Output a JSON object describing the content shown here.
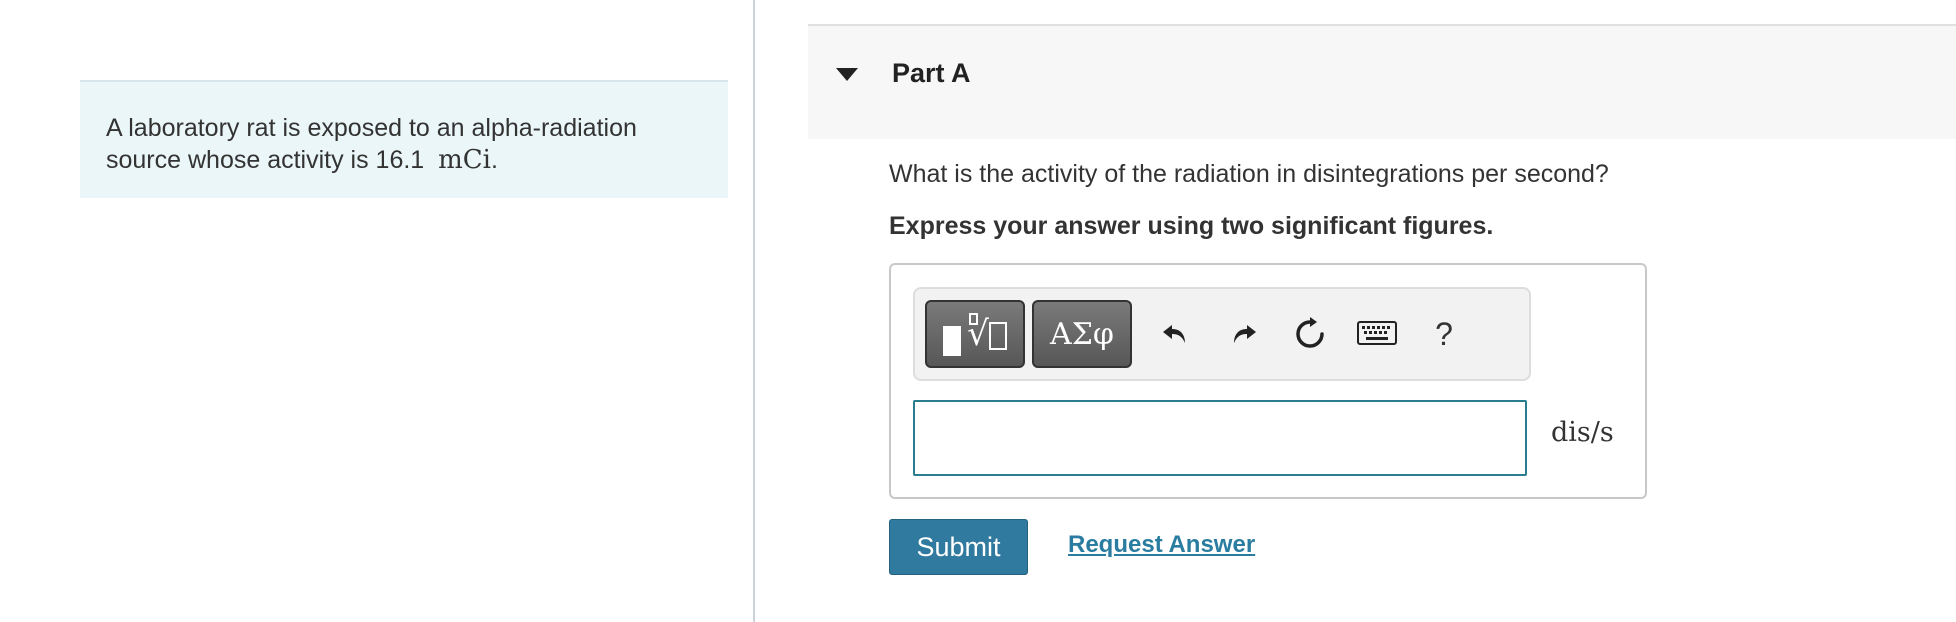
{
  "problem": {
    "text": "A laboratory rat is exposed to an alpha-radiation source whose activity is 16.1",
    "unit": "mCi",
    "trailing": "."
  },
  "part": {
    "title": "Part A"
  },
  "question": {
    "text": "What is the activity of the radiation in disintegrations per second?",
    "instruction": "Express your answer using two significant figures."
  },
  "toolbar": {
    "greek_label": "ΑΣφ",
    "help_label": "?",
    "icons": [
      "templates-icon",
      "undo-icon",
      "redo-icon",
      "reset-icon",
      "keyboard-icon",
      "help-icon"
    ]
  },
  "answer": {
    "value": "",
    "unit": "dis/s"
  },
  "actions": {
    "submit_label": "Submit",
    "request_label": "Request Answer"
  },
  "colors": {
    "accent": "#2f7a9e",
    "input_border": "#2a7d8f",
    "problem_bg": "#eaf6f7"
  }
}
